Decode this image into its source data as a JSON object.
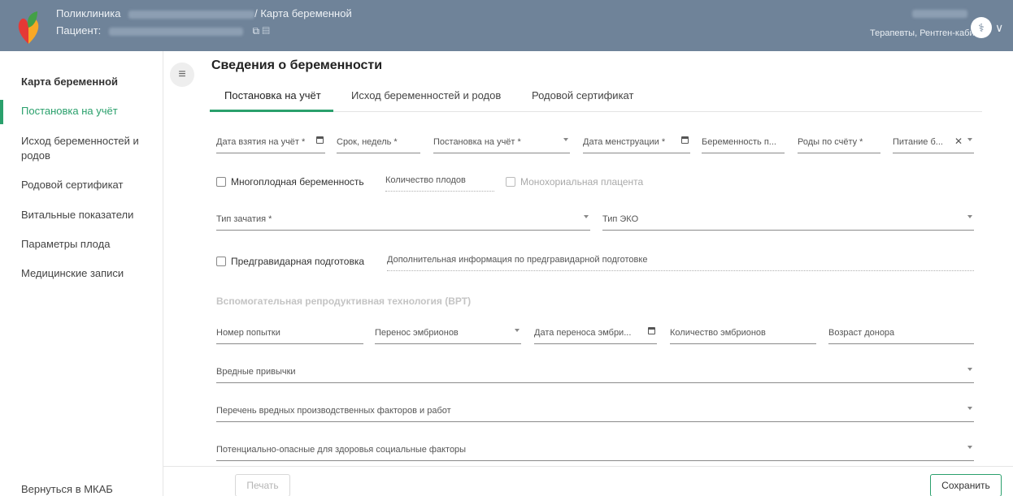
{
  "header": {
    "clinic_label": "Поликлиника",
    "breadcrumb_current": "/ Карта беременной",
    "patient_label": "Пациент:",
    "user_role": "Терапевты, Рентген-кабинет",
    "colors": {
      "bar": "#6f8399",
      "accent": "#2aa06c"
    }
  },
  "sidebar": {
    "title": "Карта беременной",
    "items": [
      {
        "label": "Постановка на учёт",
        "active": true
      },
      {
        "label": "Исход беременностей и родов"
      },
      {
        "label": "Родовой сертификат"
      },
      {
        "label": "Витальные показатели"
      },
      {
        "label": "Параметры плода"
      },
      {
        "label": "Медицинские записи"
      }
    ],
    "back_link": "Вернуться в МКАБ"
  },
  "main": {
    "title": "Сведения о беременности",
    "tabs": [
      {
        "label": "Постановка на учёт",
        "active": true
      },
      {
        "label": "Исход беременностей и родов"
      },
      {
        "label": "Родовой сертификат"
      }
    ],
    "row1": {
      "date_registered": "Дата взятия на учёт *",
      "term_weeks": "Срок, недель *",
      "registration": "Постановка на учёт *",
      "menstruation_date": "Дата менструации *",
      "pregnancy_num": "Беременность п...",
      "births_num": "Роды по счёту *",
      "nutrition": "Питание б..."
    },
    "row2": {
      "multiple_pregnancy": "Многоплодная беременность",
      "fetus_count": "Количество плодов",
      "monochorionic": "Монохориальная плацента"
    },
    "row3": {
      "conception_type": "Тип зачатия *",
      "ivf_type": "Тип ЭКО"
    },
    "row4": {
      "pregravid": "Предгравидарная подготовка",
      "pregravid_info": "Дополнительная информация по предгравидарной подготовке"
    },
    "art_section_title": "Вспомогательная репродуктивная технология (ВРТ)",
    "row5": {
      "attempt_number": "Номер попытки",
      "embryo_transfer": "Перенос эмбрионов",
      "embryo_transfer_date": "Дата переноса эмбри...",
      "embryo_count": "Количество эмбрионов",
      "donor_age": "Возраст донора"
    },
    "habits": "Вредные привычки",
    "occupational": "Перечень вредных производственных факторов и работ",
    "social": "Потенциально-опасные для здоровья социальные факторы"
  },
  "footer": {
    "print_label": "Печать",
    "save_label": "Сохранить"
  }
}
